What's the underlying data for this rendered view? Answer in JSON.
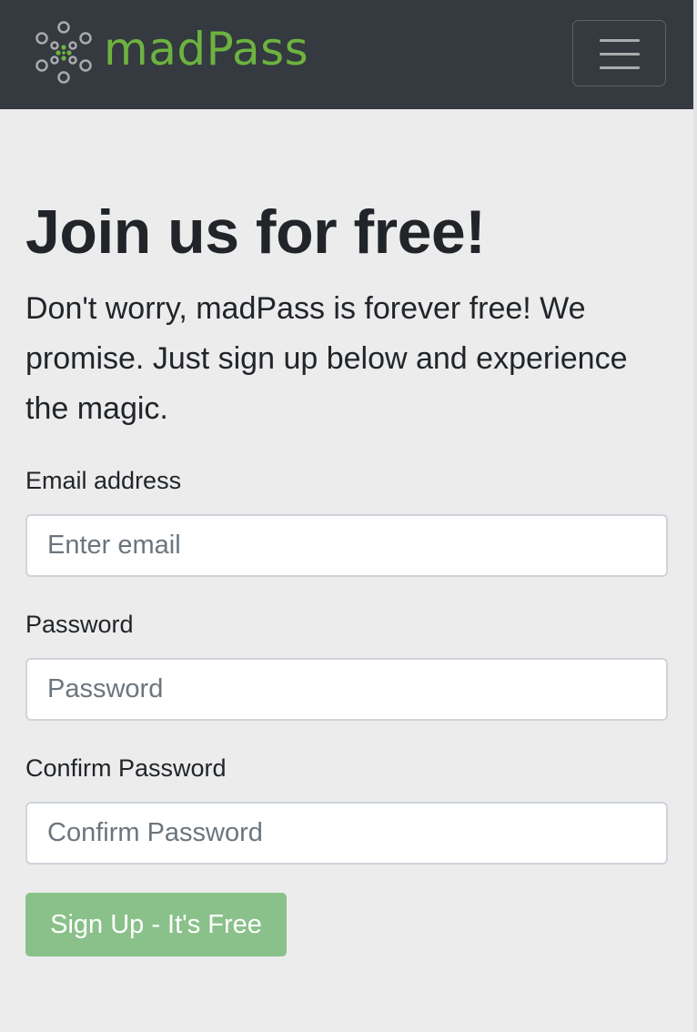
{
  "navbar": {
    "brand": "madPass",
    "brand_color": "#6db33f",
    "logo_icon": "dots-cluster-logo",
    "menu_icon": "hamburger-menu-icon",
    "background": "#343a40"
  },
  "hero": {
    "title": "Join us for free!",
    "lead": "Don't worry, madPass is forever free! We promise. Just sign up below and experience the magic."
  },
  "form": {
    "email": {
      "label": "Email address",
      "placeholder": "Enter email",
      "value": ""
    },
    "password": {
      "label": "Password",
      "placeholder": "Password",
      "value": ""
    },
    "confirm": {
      "label": "Confirm Password",
      "placeholder": "Confirm Password",
      "value": ""
    },
    "submit_label": "Sign Up - It's Free",
    "submit_color": "#8ac18a"
  }
}
